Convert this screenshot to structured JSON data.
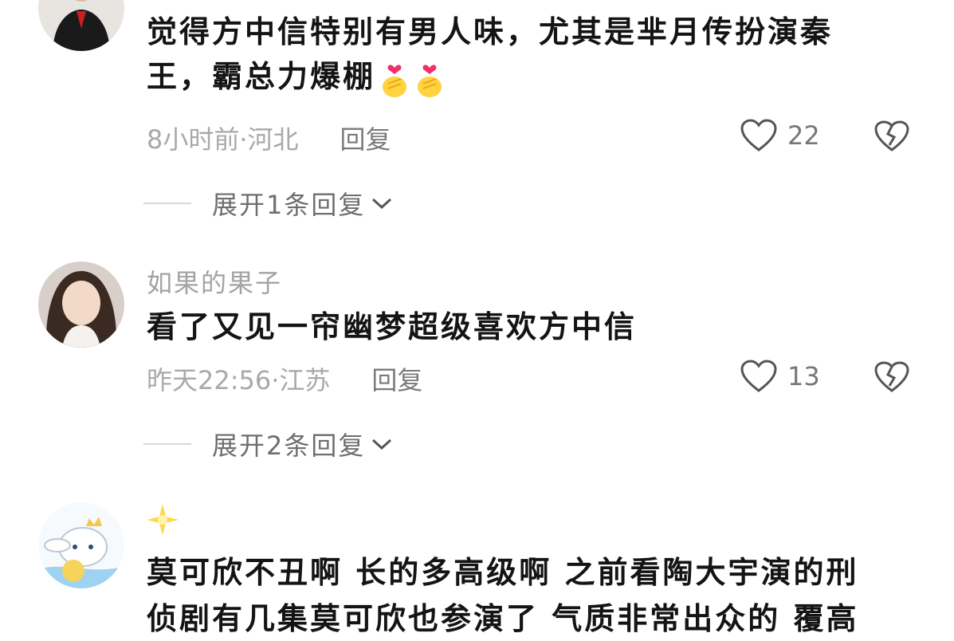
{
  "comments": [
    {
      "username": "",
      "text_line1": "觉得方中信特别有男人味，尤其是芈月传扮演秦",
      "text_line2": "王，霸总力爆棚",
      "emojis": [
        "finger-heart-emoji",
        "finger-heart-emoji"
      ],
      "time_location": "8小时前·河北",
      "reply_label": "回复",
      "likes": "22",
      "expand_label": "展开1条回复"
    },
    {
      "username": "如果的果子",
      "text_line1": "看了又见一帘幽梦超级喜欢方中信",
      "time_location": "昨天22:56·江苏",
      "reply_label": "回复",
      "likes": "13",
      "expand_label": "展开2条回复"
    },
    {
      "username_icon": "sparkle-star-icon",
      "text_line1": "莫可欣不丑啊 长的多高级啊 之前看陶大宇演的刑",
      "text_line2": "侦剧有几集莫可欣也参演了 气质非常出众的 覆高"
    }
  ],
  "colors": {
    "text": "#141414",
    "meta": "#a9a9a9",
    "icon": "#555555"
  }
}
